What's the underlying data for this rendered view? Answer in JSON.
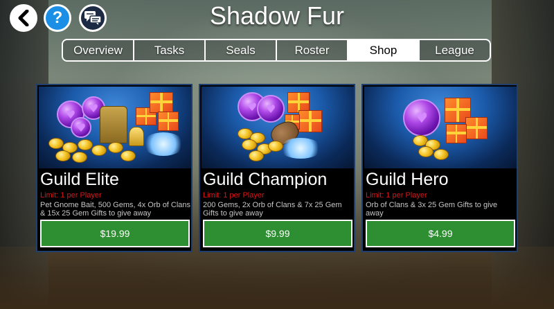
{
  "header": {
    "title": "Shadow Fur",
    "back_icon": "back-arrow-icon",
    "help_icon": "question-mark-icon",
    "chat_icon": "chat-bubbles-icon",
    "help_glyph": "?"
  },
  "tabs": [
    {
      "label": "Overview",
      "active": false
    },
    {
      "label": "Tasks",
      "active": false
    },
    {
      "label": "Seals",
      "active": false
    },
    {
      "label": "Roster",
      "active": false
    },
    {
      "label": "Shop",
      "active": true
    },
    {
      "label": "League",
      "active": false
    }
  ],
  "cards": [
    {
      "title": "Guild Elite",
      "limit": "Limit: 1 per Player",
      "description": "Pet Gnome Bait, 500 Gems, 4x Orb of Clans & 15x 25 Gem Gifts to give away",
      "price": "$19.99"
    },
    {
      "title": "Guild Champion",
      "limit": "Limit: 1 per Player",
      "description": "200 Gems, 2x Orb of Clans & 7x 25 Gem Gifts to give away",
      "price": "$9.99"
    },
    {
      "title": "Guild Hero",
      "limit": "Limit: 1 per Player",
      "description": "Orb of Clans & 3x 25 Gem Gifts to give away",
      "price": "$4.99"
    }
  ],
  "colors": {
    "accent_green": "#2e8f32",
    "limit_red": "#e01616",
    "help_blue": "#1b8fe6",
    "card_border": "#1f3f6e"
  }
}
